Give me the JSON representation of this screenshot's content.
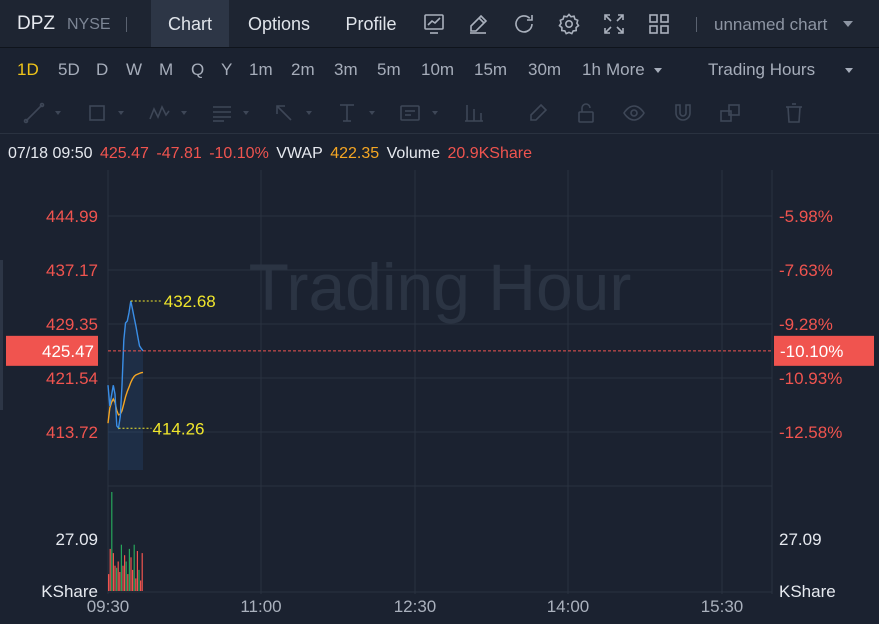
{
  "colors": {
    "background": "#1b2230",
    "grid": "#2a3240",
    "up": "#26a65b",
    "down": "#f0544f",
    "price_line": "#3a8ee6",
    "vwap_line": "#f5a623",
    "label_yellow": "#f0e62c",
    "active_interval": "#f0c419"
  },
  "header": {
    "symbol": "DPZ",
    "exchange": "NYSE",
    "tabs": [
      {
        "label": "Chart",
        "active": true
      },
      {
        "label": "Options",
        "active": false
      },
      {
        "label": "Profile",
        "active": false
      }
    ],
    "icons": [
      "indicator-icon",
      "draw-icon",
      "refresh-icon",
      "settings-icon",
      "fullscreen-icon",
      "layout-grid-icon"
    ],
    "chart_name": "unnamed chart"
  },
  "intervals": {
    "items": [
      "1D",
      "5D",
      "D",
      "W",
      "M",
      "Q",
      "Y",
      "1m",
      "2m",
      "3m",
      "5m",
      "10m",
      "15m",
      "30m",
      "1h"
    ],
    "active": "1D",
    "more_label": "More",
    "session_label": "Trading Hours"
  },
  "drawing_tools": [
    "trend-line-icon",
    "rectangle-icon",
    "pattern-icon",
    "fib-icon",
    "arrow-icon",
    "text-cursor-icon",
    "annotation-icon",
    "measure-icon",
    "pencil-icon",
    "lock-icon",
    "eye-icon",
    "magnet-icon",
    "clone-icon",
    "trash-icon"
  ],
  "info": {
    "datetime": "07/18 09:50",
    "price": "425.47",
    "change": "-47.81",
    "change_pct": "-10.10%",
    "vwap_label": "VWAP",
    "vwap_value": "422.35",
    "volume_label": "Volume",
    "volume_value": "20.9KShare"
  },
  "chart_data": {
    "type": "line",
    "watermark": "Trading Hour",
    "x_ticks": [
      "09:30",
      "11:00",
      "12:30",
      "14:00",
      "15:30"
    ],
    "y_ticks_left": [
      "444.99",
      "437.17",
      "429.35",
      "421.54",
      "413.72"
    ],
    "y_ticks_right": [
      "-5.98%",
      "-7.63%",
      "-9.28%",
      "-10.93%",
      "-12.58%"
    ],
    "current_price": "425.47",
    "current_change_pct": "-10.10%",
    "high_label": "432.68",
    "low_label": "414.26",
    "ylim": [
      411,
      448
    ],
    "series": [
      {
        "name": "price",
        "x": [
          0,
          1,
          2,
          3,
          4,
          5,
          6,
          7,
          8,
          9,
          10,
          11,
          12,
          13,
          14,
          15,
          16,
          17,
          18,
          19,
          20
        ],
        "values": [
          420.5,
          417.5,
          419.0,
          420.5,
          419.2,
          414.6,
          414.3,
          416.0,
          420.5,
          427.0,
          429.5,
          429.8,
          431.0,
          432.68,
          431.5,
          430.2,
          429.0,
          427.5,
          426.2,
          425.8,
          425.47
        ]
      },
      {
        "name": "VWAP",
        "x": [
          0,
          1,
          2,
          3,
          4,
          5,
          6,
          7,
          8,
          9,
          10,
          11,
          12,
          13,
          14,
          15,
          16,
          17,
          18,
          19,
          20
        ],
        "values": [
          415.0,
          417.2,
          418.0,
          418.5,
          418.0,
          416.8,
          416.2,
          416.3,
          416.8,
          417.8,
          418.8,
          419.6,
          420.2,
          420.9,
          421.4,
          421.8,
          422.0,
          422.1,
          422.2,
          422.3,
          422.35
        ]
      }
    ],
    "volume": {
      "label_value": "27.09",
      "unit": "KShare",
      "max": 47,
      "values": [
        8,
        20,
        47,
        18,
        12,
        11,
        14,
        9,
        22,
        12,
        17,
        14,
        8,
        20,
        16,
        10,
        22,
        6,
        19,
        10,
        5,
        18
      ],
      "colors": [
        "down",
        "down",
        "up",
        "down",
        "down",
        "up",
        "down",
        "down",
        "up",
        "down",
        "down",
        "up",
        "down",
        "up",
        "down",
        "down",
        "up",
        "down",
        "down",
        "up",
        "down",
        "down"
      ]
    }
  }
}
